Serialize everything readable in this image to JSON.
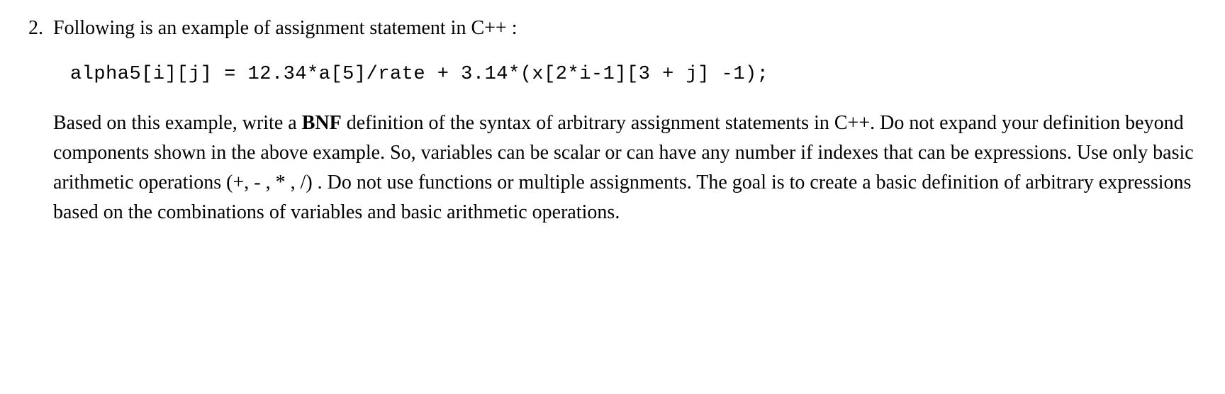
{
  "question": {
    "number": "2.",
    "intro": "Following is an example of assignment statement in C++ :",
    "code": "alpha5[i][j] = 12.34*a[5]/rate + 3.14*(x[2*i-1][3 + j] -1);",
    "description_part1": "Based on this example, write a ",
    "description_bold": "BNF",
    "description_part2": " definition of the syntax of arbitrary assignment statements in C++. Do not expand your definition beyond components shown in the above example. So, variables can be scalar or can have any number if indexes that can be expressions. Use only basic arithmetic operations (+, - , * , /) . Do not use functions or multiple assignments. The goal is to create a basic definition of arbitrary expressions based on the combinations of variables and basic arithmetic operations."
  }
}
